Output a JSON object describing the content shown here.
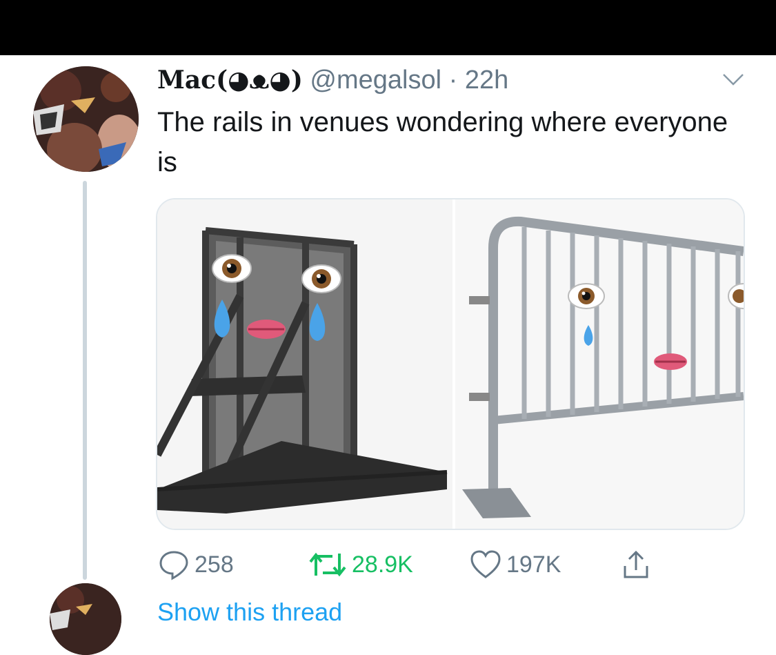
{
  "tweet": {
    "display_name": "Mac(◕ᴥ◕)",
    "handle": "@megalsol",
    "separator": " · ",
    "time": "22h",
    "text": "The rails in venues wondering where everyone is",
    "media": [
      {
        "alt": "crowd barrier with eye, tear and lips emoji"
      },
      {
        "alt": "metal bike-rack barricade with eye, tear and lips emoji"
      }
    ]
  },
  "actions": {
    "replies": "258",
    "retweets": "28.9K",
    "likes": "197K"
  },
  "thread": {
    "show_thread_label": "Show this thread"
  },
  "icons": {
    "more": "chevron-down-icon",
    "reply": "reply-icon",
    "retweet": "retweet-icon",
    "like": "heart-icon",
    "share": "share-icon"
  },
  "colors": {
    "text": "#14171a",
    "secondary": "#657786",
    "retweet_active": "#17bf63",
    "link": "#1da1f2",
    "divider": "#e1e8ed"
  }
}
